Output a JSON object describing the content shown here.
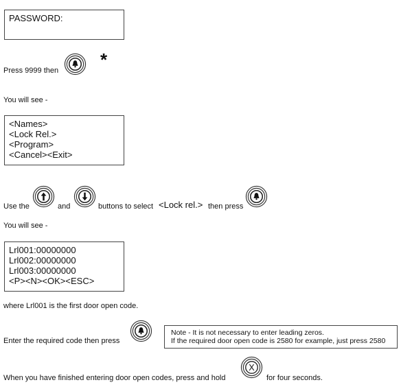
{
  "password_display": {
    "label": "PASSWORD:"
  },
  "step1": {
    "text": "Press 9999 then",
    "star": "*"
  },
  "you_will_see_1": "You will see -",
  "menu_display": {
    "lines": [
      "<Names>",
      "<Lock Rel.>",
      "<Program>",
      "<Cancel><Exit>"
    ]
  },
  "step2": {
    "use_the": "Use the",
    "and": "and",
    "buttons_to_select": "buttons to select",
    "selection": "<Lock rel.>",
    "then_press": "then press"
  },
  "you_will_see_2": "You will see -",
  "lockrel_display": {
    "lines": [
      "Lrl001:00000000",
      "Lrl002:00000000",
      "Lrl003:00000000",
      "<P><N><OK><ESC>"
    ]
  },
  "explanation": "where Lrl001 is the first door open code.",
  "step3": {
    "text": "Enter the required code then press"
  },
  "note": {
    "lines": [
      "Note - It is not necessary to enter leading zeros.",
      "If the required door open code is 2580 for example, just press 2580"
    ]
  },
  "step4": {
    "before": "When you have finished entering door open codes, press and hold",
    "after": "for four seconds."
  },
  "icons": {
    "bell": "bell-button",
    "up": "up-arrow-button",
    "down": "down-arrow-button",
    "cancel": "x-cancel-button",
    "cancel_glyph": "X"
  }
}
